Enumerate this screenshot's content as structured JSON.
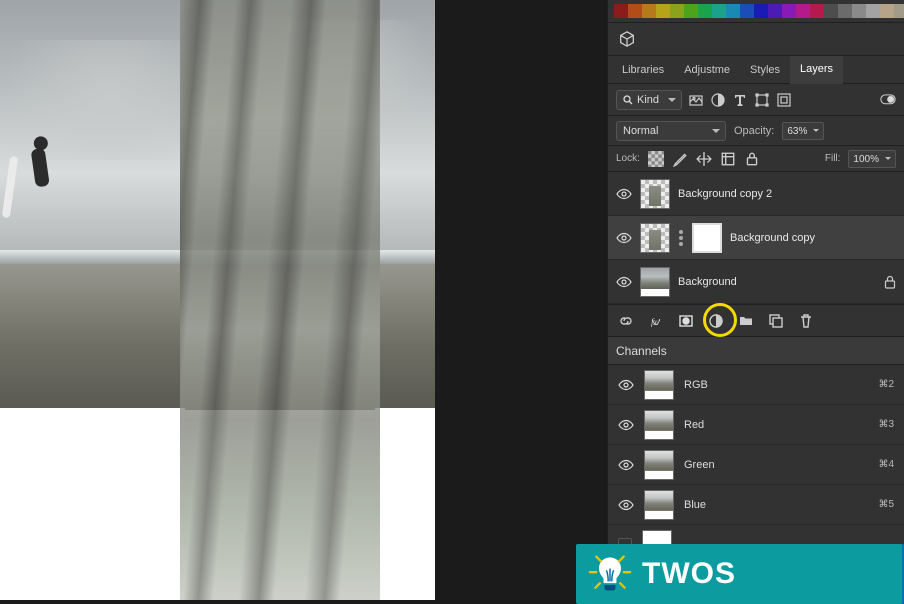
{
  "swatches_colors": [
    "#8a1c1c",
    "#b24d1a",
    "#b57a1a",
    "#b5a31a",
    "#8aa31a",
    "#4da31a",
    "#1aa34d",
    "#1aa38a",
    "#1a8ab5",
    "#1a4db5",
    "#1a1ab5",
    "#4d1ab5",
    "#8a1ab5",
    "#b51a8a",
    "#b51a4d",
    "#4d4d4d",
    "#6b6b6b",
    "#8a8a8a",
    "#a3a3a3",
    "#b5a38a",
    "#a39b8a",
    "#a38a6b",
    "#b5a37a",
    "#072a4d"
  ],
  "tabs": [
    {
      "id": "libraries",
      "label": "Libraries"
    },
    {
      "id": "adjustments",
      "label": "Adjustme"
    },
    {
      "id": "styles",
      "label": "Styles"
    },
    {
      "id": "layers",
      "label": "Layers"
    }
  ],
  "active_tab": "layers",
  "filter": {
    "kind": "Kind"
  },
  "blend": {
    "mode": "Normal",
    "opacity_label": "Opacity:",
    "opacity_value": "63%"
  },
  "lock": {
    "label": "Lock:",
    "fill_label": "Fill:",
    "fill_value": "100%"
  },
  "layers": [
    {
      "name": "Background copy 2",
      "selected": false,
      "mask": false,
      "locked": false
    },
    {
      "name": "Background copy",
      "selected": true,
      "mask": true,
      "locked": false
    },
    {
      "name": "Background",
      "selected": false,
      "mask": false,
      "locked": true
    }
  ],
  "channels_title": "Channels",
  "channels": [
    {
      "name": "RGB",
      "key": "⌘2"
    },
    {
      "name": "Red",
      "key": "⌘3"
    },
    {
      "name": "Green",
      "key": "⌘4"
    },
    {
      "name": "Blue",
      "key": "⌘5"
    }
  ],
  "watermark_text": "TWOS"
}
